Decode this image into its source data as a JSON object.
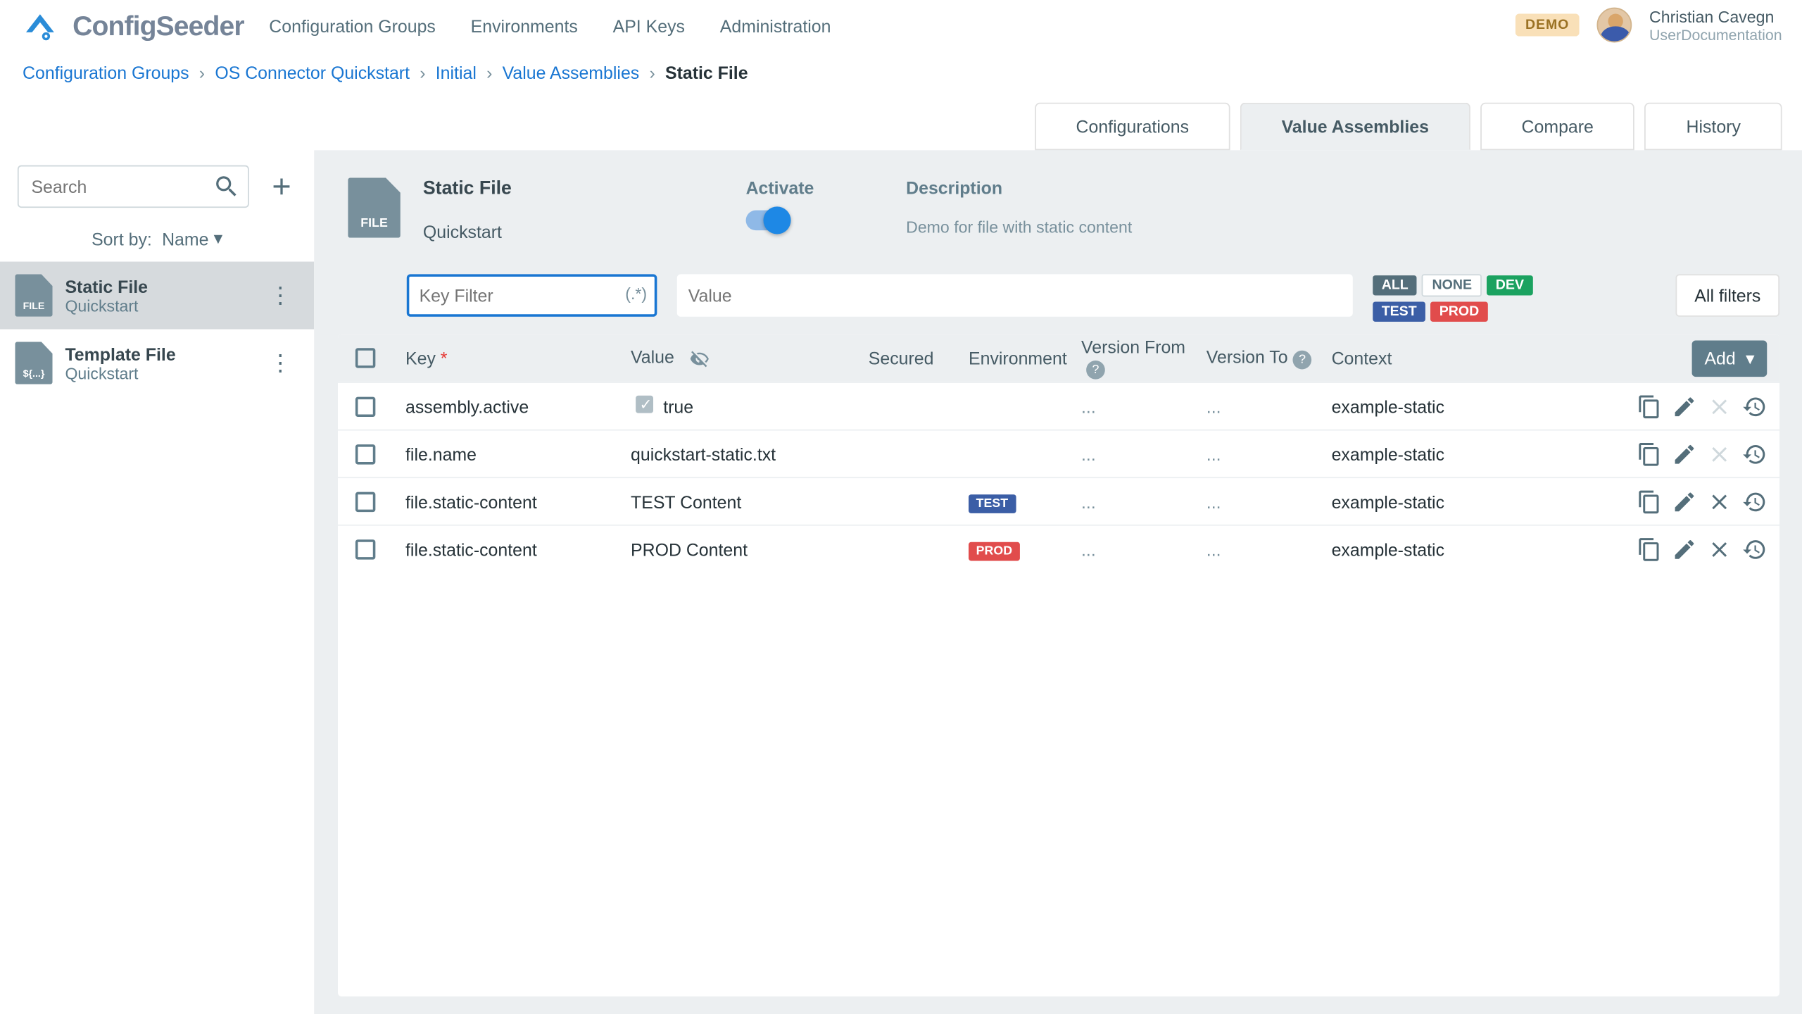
{
  "brand": "ConfigSeeder",
  "topnav": [
    "Configuration Groups",
    "Environments",
    "API Keys",
    "Administration"
  ],
  "demo_badge": "DEMO",
  "user": {
    "name": "Christian Cavegn",
    "role": "UserDocumentation"
  },
  "breadcrumb": {
    "items": [
      "Configuration Groups",
      "OS Connector Quickstart",
      "Initial",
      "Value Assemblies"
    ],
    "current": "Static File"
  },
  "tabs": [
    "Configurations",
    "Value Assemblies",
    "Compare",
    "History"
  ],
  "tabs_active_index": 1,
  "sidebar": {
    "search_placeholder": "Search",
    "sort_label": "Sort by:",
    "sort_value": "Name",
    "items": [
      {
        "title": "Static File",
        "subtitle": "Quickstart",
        "icon_label": "FILE",
        "active": true
      },
      {
        "title": "Template File",
        "subtitle": "Quickstart",
        "icon_label": "${...}",
        "active": false
      }
    ]
  },
  "detail": {
    "icon_label": "FILE",
    "title": "Static File",
    "subtitle": "Quickstart",
    "activate_label": "Activate",
    "description_label": "Description",
    "description_text": "Demo for file with static content"
  },
  "filters": {
    "key_placeholder": "Key Filter",
    "regex_hint": "(.*)",
    "value_placeholder": "Value",
    "chips": [
      "ALL",
      "NONE",
      "DEV",
      "TEST",
      "PROD"
    ],
    "all_filters": "All filters"
  },
  "table": {
    "columns": {
      "key": "Key",
      "value": "Value",
      "secured": "Secured",
      "environment": "Environment",
      "version_from": "Version From",
      "version_to": "Version To",
      "context": "Context",
      "add": "Add"
    },
    "rows": [
      {
        "key": "assembly.active",
        "value": "true",
        "value_checkbox": true,
        "env": "",
        "vfrom": "...",
        "vto": "...",
        "context": "example-static",
        "deletable": false
      },
      {
        "key": "file.name",
        "value": "quickstart-static.txt",
        "value_checkbox": false,
        "env": "",
        "vfrom": "...",
        "vto": "...",
        "context": "example-static",
        "deletable": false
      },
      {
        "key": "file.static-content",
        "value": "TEST Content",
        "value_checkbox": false,
        "env": "TEST",
        "vfrom": "...",
        "vto": "...",
        "context": "example-static",
        "deletable": true
      },
      {
        "key": "file.static-content",
        "value": "PROD Content",
        "value_checkbox": false,
        "env": "PROD",
        "vfrom": "...",
        "vto": "...",
        "context": "example-static",
        "deletable": true
      }
    ]
  }
}
